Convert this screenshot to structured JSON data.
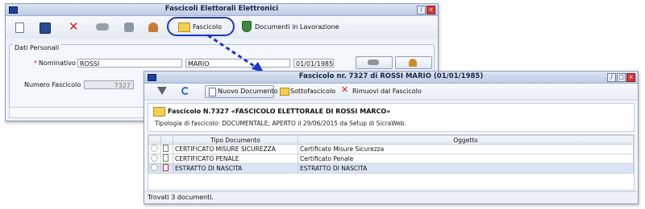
{
  "main_window": {
    "title": "Fascicoli Elettorali Elettronici",
    "toolbar": {
      "fascicolo_label": "Fascicolo",
      "documenti_label": "Documenti in Lavorazione"
    },
    "section_label": "Dati Personali",
    "required_mark": "*",
    "nominativo_label": "Nominativo",
    "surname": "ROSSI",
    "name": "MARIO",
    "birth_date": "01/01/1985",
    "numero_label": "Numero Fascicolo",
    "numero_value": "7327"
  },
  "fascicolo_window": {
    "title": "Fascicolo  nr. 7327 di ROSSI MARIO (01/01/1985)",
    "toolbar": {
      "nuovo_label": "Nuovo Documento",
      "sotto_label": "Sottofascicolo",
      "rimuovi_label": "Rimuovi dal Fascicolo"
    },
    "header_title": "Fascicolo N.7327 «FASCICOLO ELETTORALE DI ROSSI MARCO»",
    "header_subtitle": "Tipologia di fascicolo: DOCUMENTALE; APERTO il 29/06/2015 da Setup di SicraWeb.",
    "columns": [
      "Tipo Documento",
      "Oggetto"
    ],
    "rows": [
      {
        "tipo": "CERTIFICATO MISURE SICUREZZA",
        "oggetto": "Certificato Misure Sicurezza"
      },
      {
        "tipo": "CERTIFICATO PENALE",
        "oggetto": "Certificato Penale"
      },
      {
        "tipo": "ESTRATTO DI NASCITA",
        "oggetto": "ESTRATTO DI NASCITA"
      }
    ],
    "status": "Trovati 3 documenti."
  },
  "colors": {
    "highlight_ring": "#1e34c8",
    "arrow": "#1e34c8",
    "selected_row": "#d9e4f5",
    "delete_red": "#d02020"
  }
}
